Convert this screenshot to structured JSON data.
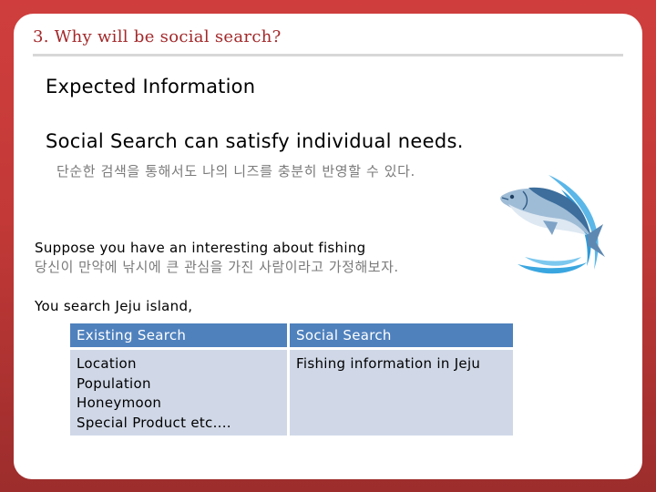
{
  "slide": {
    "title": "3. Why will be social search?",
    "heading": "Expected Information",
    "claim": "Social Search can satisfy individual needs.",
    "claim_korean": "단순한 검색을 통해서도 나의 니즈를 충분히 반영할 수 있다.",
    "scenario": "Suppose you have an interesting about fishing",
    "scenario_korean": "당신이 만약에 낚시에 큰 관심을 가진 사람이라고 가정해보자.",
    "search_line": "You search Jeju island,",
    "illustration": "leaping-fish-icon"
  },
  "table": {
    "headers": [
      "Existing Search",
      "Social Search"
    ],
    "existing_items": [
      "Location",
      "Population",
      "Honeymoon",
      "Special Product etc...."
    ],
    "social_items": [
      "Fishing information in Jeju"
    ]
  },
  "colors": {
    "frame_top": "#cf3e3d",
    "frame_bottom": "#9c2d2c",
    "title": "#a3282a",
    "table_header": "#4f81bd",
    "table_body": "#d0d8e7",
    "korean_text": "#7a7a7a"
  }
}
